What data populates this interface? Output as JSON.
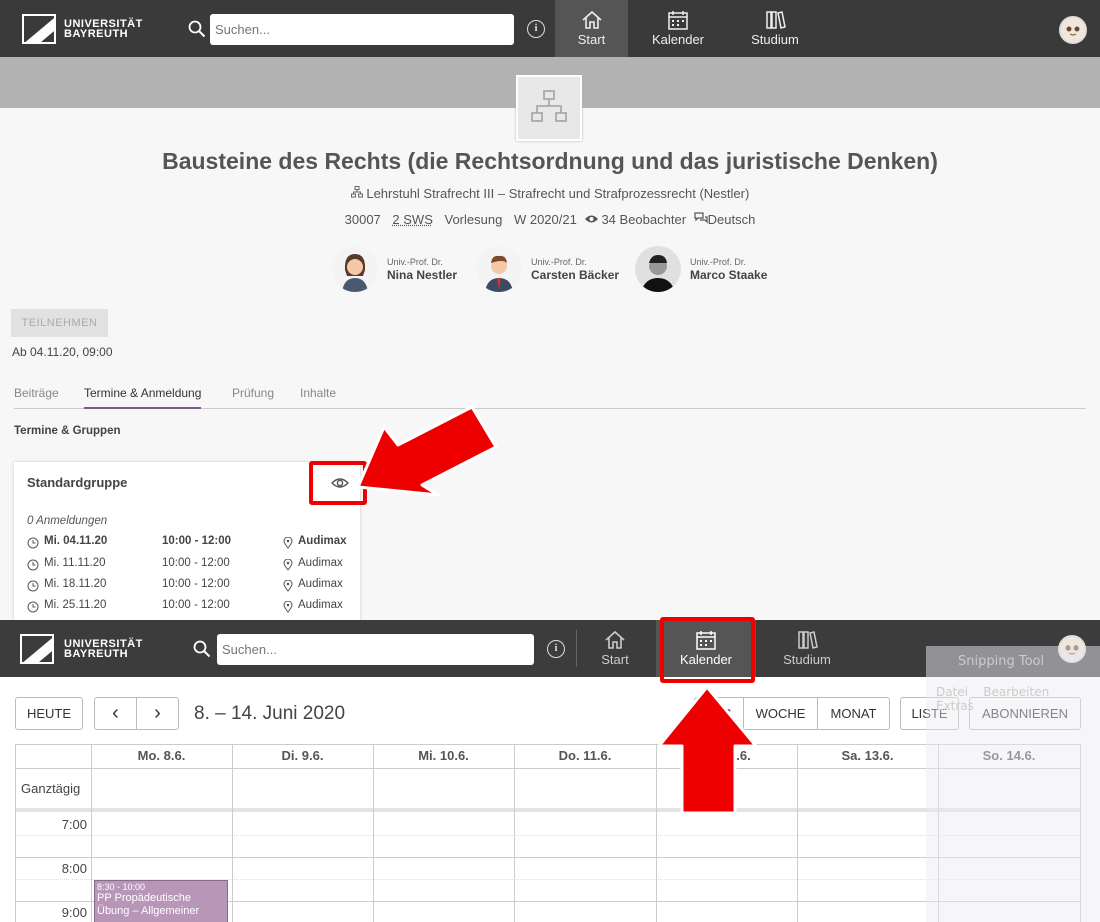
{
  "top_nav": {
    "logo_line1": "UNIVERSITÄT",
    "logo_line2": "BAYREUTH",
    "search_placeholder": "Suchen...",
    "items": [
      {
        "label": "Start",
        "icon": "home-icon",
        "active": true
      },
      {
        "label": "Kalender",
        "icon": "calendar-icon",
        "active": false
      },
      {
        "label": "Studium",
        "icon": "books-icon",
        "active": false
      }
    ]
  },
  "course": {
    "title": "Bausteine des Rechts (die Rechtsordnung und das juristische Denken)",
    "institute": "Lehrstuhl Strafrecht III – Strafrecht und Strafprozessrecht (Nestler)",
    "number": "30007",
    "sws": "2 SWS",
    "type": "Vorlesung",
    "semester": "W 2020/21",
    "observers": "34 Beobachter",
    "language": "Deutsch",
    "lecturers": [
      {
        "role": "Univ.-Prof. Dr.",
        "name": "Nina Nestler"
      },
      {
        "role": "Univ.-Prof. Dr.",
        "name": "Carsten Bäcker"
      },
      {
        "role": "Univ.-Prof. Dr.",
        "name": "Marco Staake"
      }
    ],
    "join_button": "TEILNEHMEN",
    "from_date": "Ab 04.11.20, 09:00"
  },
  "tabs": [
    "Beiträge",
    "Termine & Anmeldung",
    "Prüfung",
    "Inhalte"
  ],
  "active_tab": "Termine & Anmeldung",
  "section_heading": "Termine & Gruppen",
  "group": {
    "title": "Standardgruppe",
    "registrations": "0 Anmeldungen",
    "dates": [
      {
        "date": "Mi. 04.11.20",
        "time": "10:00 - 12:00",
        "location": "Audimax"
      },
      {
        "date": "Mi. 11.11.20",
        "time": "10:00 - 12:00",
        "location": "Audimax"
      },
      {
        "date": "Mi. 18.11.20",
        "time": "10:00 - 12:00",
        "location": "Audimax"
      },
      {
        "date": "Mi. 25.11.20",
        "time": "10:00 - 12:00",
        "location": "Audimax"
      }
    ]
  },
  "bottom_nav": {
    "logo_line1": "UNIVERSITÄT",
    "logo_line2": "BAYREUTH",
    "search_placeholder": "Suchen...",
    "items": [
      {
        "label": "Start",
        "icon": "home-icon",
        "active": false
      },
      {
        "label": "Kalender",
        "icon": "calendar-icon",
        "active": true
      },
      {
        "label": "Studium",
        "icon": "books-icon",
        "active": false
      }
    ]
  },
  "calendar": {
    "today_button": "HEUTE",
    "prev": "‹",
    "next": "›",
    "range_title": "8. – 14. Juni 2020",
    "view_buttons": [
      "TAG",
      "WOCHE",
      "MONAT"
    ],
    "list_button": "LISTE",
    "subscribe_button": "ABONNIEREN",
    "all_day_label": "Ganztägig",
    "days": [
      "Mo. 8.6.",
      "Di. 9.6.",
      "Mi. 10.6.",
      "Do. 11.6.",
      "Fr. 12.6.",
      "Sa. 13.6.",
      "So. 14.6."
    ],
    "hours": [
      "7:00",
      "8:00",
      "9:00"
    ],
    "event": {
      "time": "8:30 - 10:00",
      "title": "PP Propädeutische Übung – Allgemeiner"
    },
    "event_color": "#b896b8",
    "overlay_text": [
      "Snipping Tool",
      "Datei",
      "Bearbeiten",
      "Extras"
    ]
  },
  "colors": {
    "highlight": "#e00000",
    "nav_bg": "#3a3a3a",
    "tab_accent": "#7a5a8a"
  }
}
